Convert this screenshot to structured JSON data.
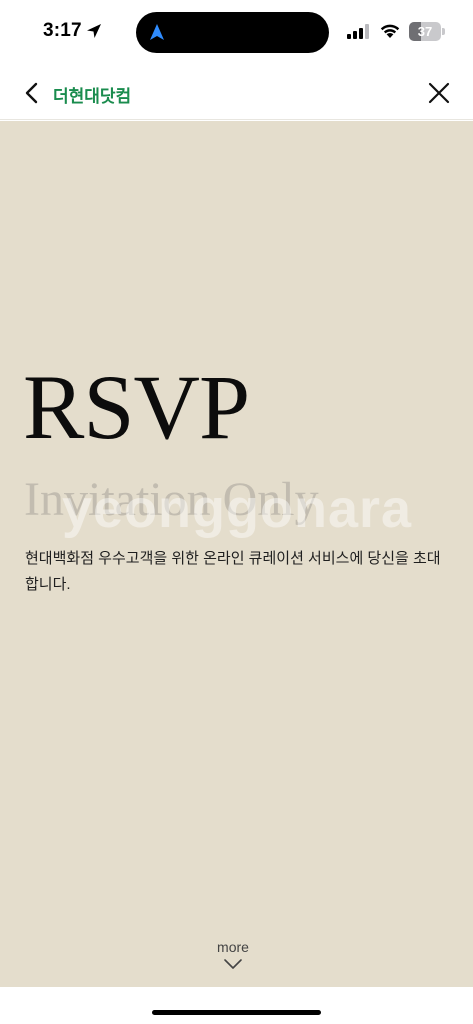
{
  "status_bar": {
    "time": "3:17",
    "battery_level": "37",
    "battery_fraction": 0.37,
    "icons": [
      "location-arrow-icon",
      "navigation-icon",
      "cellular-signal-icon",
      "wifi-icon",
      "battery-icon"
    ]
  },
  "nav": {
    "title": "더현대닷컴",
    "back_icon": "chevron-left-icon",
    "close_icon": "close-icon",
    "title_color": "#1a8c4e"
  },
  "content": {
    "background_color": "#e4ddcc",
    "heading": "RSVP",
    "subheading": "Invitation Only",
    "watermark": "yeonggonara",
    "description": "현대백화점 우수고객을 위한 온라인 큐레이션 서비스에 당신을 초대합니다.",
    "more_label": "more",
    "more_icon": "chevron-down-icon"
  }
}
